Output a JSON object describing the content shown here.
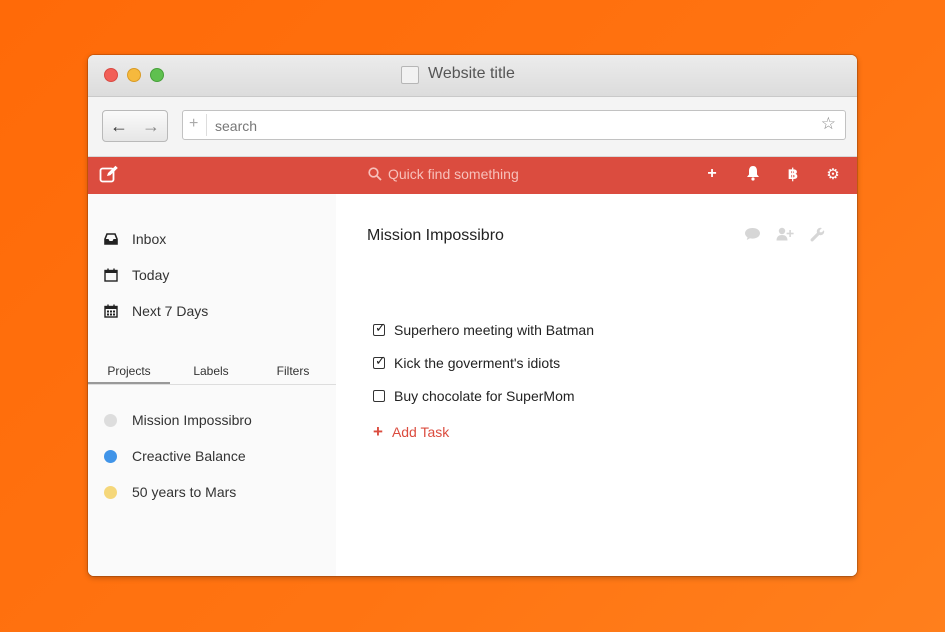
{
  "window": {
    "title": "Website title"
  },
  "browser": {
    "search": {
      "placeholder": "search",
      "value": ""
    }
  },
  "appbar": {
    "quickfind_placeholder": "Quick find something"
  },
  "sidebar": {
    "nav": [
      {
        "label": "Inbox",
        "icon": "inbox-icon"
      },
      {
        "label": "Today",
        "icon": "calendar-icon"
      },
      {
        "label": "Next 7 Days",
        "icon": "calendar-week-icon"
      }
    ],
    "tabs": [
      {
        "label": "Projects",
        "active": true
      },
      {
        "label": "Labels",
        "active": false
      },
      {
        "label": "Filters",
        "active": false
      }
    ],
    "projects": [
      {
        "label": "Mission Impossibro",
        "color": "#dddddd"
      },
      {
        "label": "Creactive Balance",
        "color": "#4094e8"
      },
      {
        "label": "50 years to Mars",
        "color": "#f5d77a"
      }
    ]
  },
  "main": {
    "title": "Mission Impossibro",
    "tasks": [
      {
        "label": "Superhero meeting with Batman",
        "done": true
      },
      {
        "label": "Kick the goverment's idiots",
        "done": true
      },
      {
        "label": "Buy chocolate for SuperMom",
        "done": false
      }
    ],
    "add_task_label": "Add Task"
  },
  "colors": {
    "accent": "#db4c3f",
    "background": "#ff7010"
  }
}
